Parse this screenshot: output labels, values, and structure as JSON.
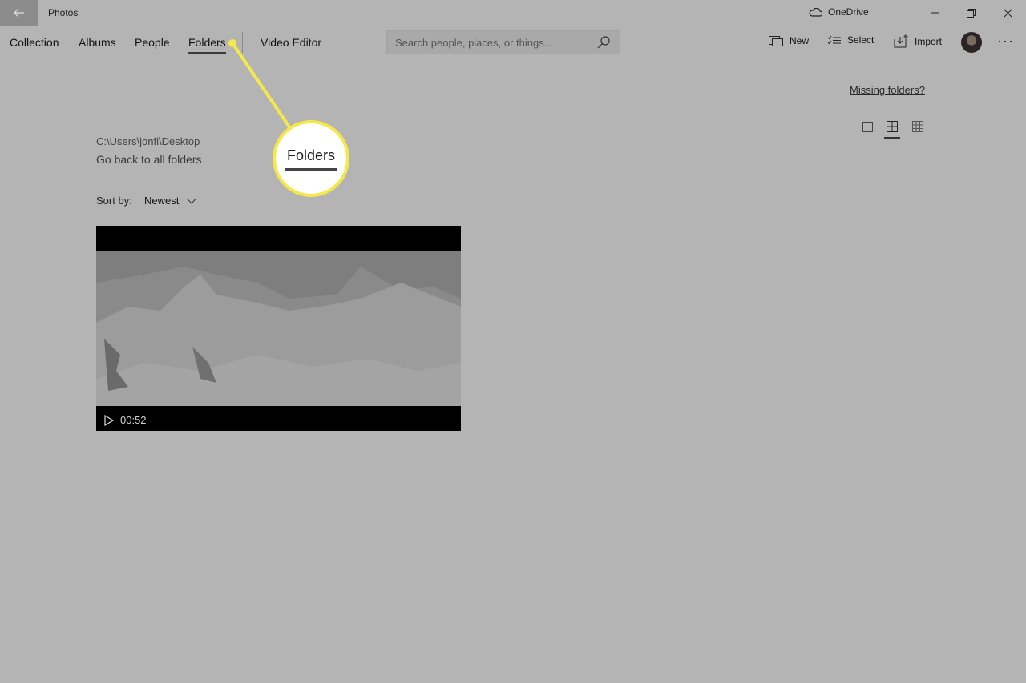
{
  "window": {
    "app_title": "Photos",
    "onedrive_label": "OneDrive"
  },
  "nav": {
    "tabs": [
      {
        "label": "Collection"
      },
      {
        "label": "Albums"
      },
      {
        "label": "People"
      },
      {
        "label": "Folders",
        "active": true
      },
      {
        "label": "Video Editor"
      }
    ]
  },
  "search": {
    "placeholder": "Search people, places, or things..."
  },
  "commands": {
    "new_label": "New",
    "select_label": "Select",
    "import_label": "Import"
  },
  "content": {
    "missing_folders_link": "Missing folders?",
    "path": "C:\\Users\\jonfi\\Desktop",
    "go_back": "Go back to all folders",
    "sort_label": "Sort by:",
    "sort_value": "Newest",
    "video": {
      "duration": "00:52"
    }
  },
  "callout": {
    "label": "Folders",
    "color": "#f5e84a"
  }
}
